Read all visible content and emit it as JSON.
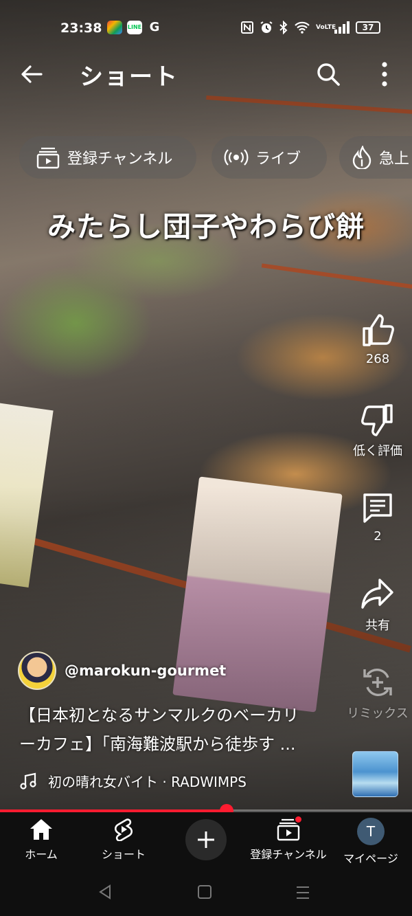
{
  "status_bar": {
    "time": "23:38",
    "app_icons": [
      "photos-icon",
      "line-icon",
      "google-icon"
    ],
    "system_icons": [
      "nfc-icon",
      "alarm-icon",
      "bluetooth-icon",
      "wifi-icon",
      "volte-icon",
      "signal-icon"
    ],
    "volte_label": "VoLTE",
    "line_label": "LINE",
    "google_label": "G",
    "battery": "37"
  },
  "header": {
    "title": "ショート",
    "icons": [
      "back-arrow-icon",
      "search-icon",
      "more-vert-icon"
    ]
  },
  "chips": [
    {
      "label": "登録チャンネル",
      "icon": "subscriptions-icon"
    },
    {
      "label": "ライブ",
      "icon": "live-icon"
    },
    {
      "label": "急上",
      "icon": "trending-icon"
    }
  ],
  "video": {
    "caption": "みたらし団子やわらび餅"
  },
  "actions": {
    "like": {
      "label": "268",
      "icon": "thumb-up-icon"
    },
    "dislike": {
      "label": "低く評価",
      "icon": "thumb-down-icon"
    },
    "comments": {
      "label": "2",
      "icon": "comment-icon"
    },
    "share": {
      "label": "共有",
      "icon": "share-icon"
    },
    "remix": {
      "label": "リミックス",
      "icon": "remix-icon"
    }
  },
  "channel": {
    "handle": "@marokun-gourmet"
  },
  "description": {
    "line1": "【日本初となるサンマルクのベーカリ",
    "line2": "ーカフェ】「南海難波駅から徒歩す ..."
  },
  "music": {
    "text": "初の晴れ女バイト · RADWIMPS",
    "icon": "music-note-icon"
  },
  "progress": {
    "fraction": 0.55
  },
  "bottom_nav": {
    "items": [
      {
        "label": "ホーム",
        "icon": "home-icon"
      },
      {
        "label": "ショート",
        "icon": "shorts-icon"
      },
      {
        "label": "",
        "icon": "create-plus-icon"
      },
      {
        "label": "登録チャンネル",
        "icon": "subscriptions-icon"
      },
      {
        "label": "マイページ",
        "icon": "avatar"
      }
    ],
    "avatar_letter": "T"
  },
  "system_nav": [
    "back-triangle-icon",
    "home-square-icon",
    "recents-lines-icon"
  ],
  "colors": {
    "accent": "#ff1c30",
    "nav_bg": "#0f0f0f",
    "chip_bg": "rgba(90,90,90,0.45)"
  }
}
